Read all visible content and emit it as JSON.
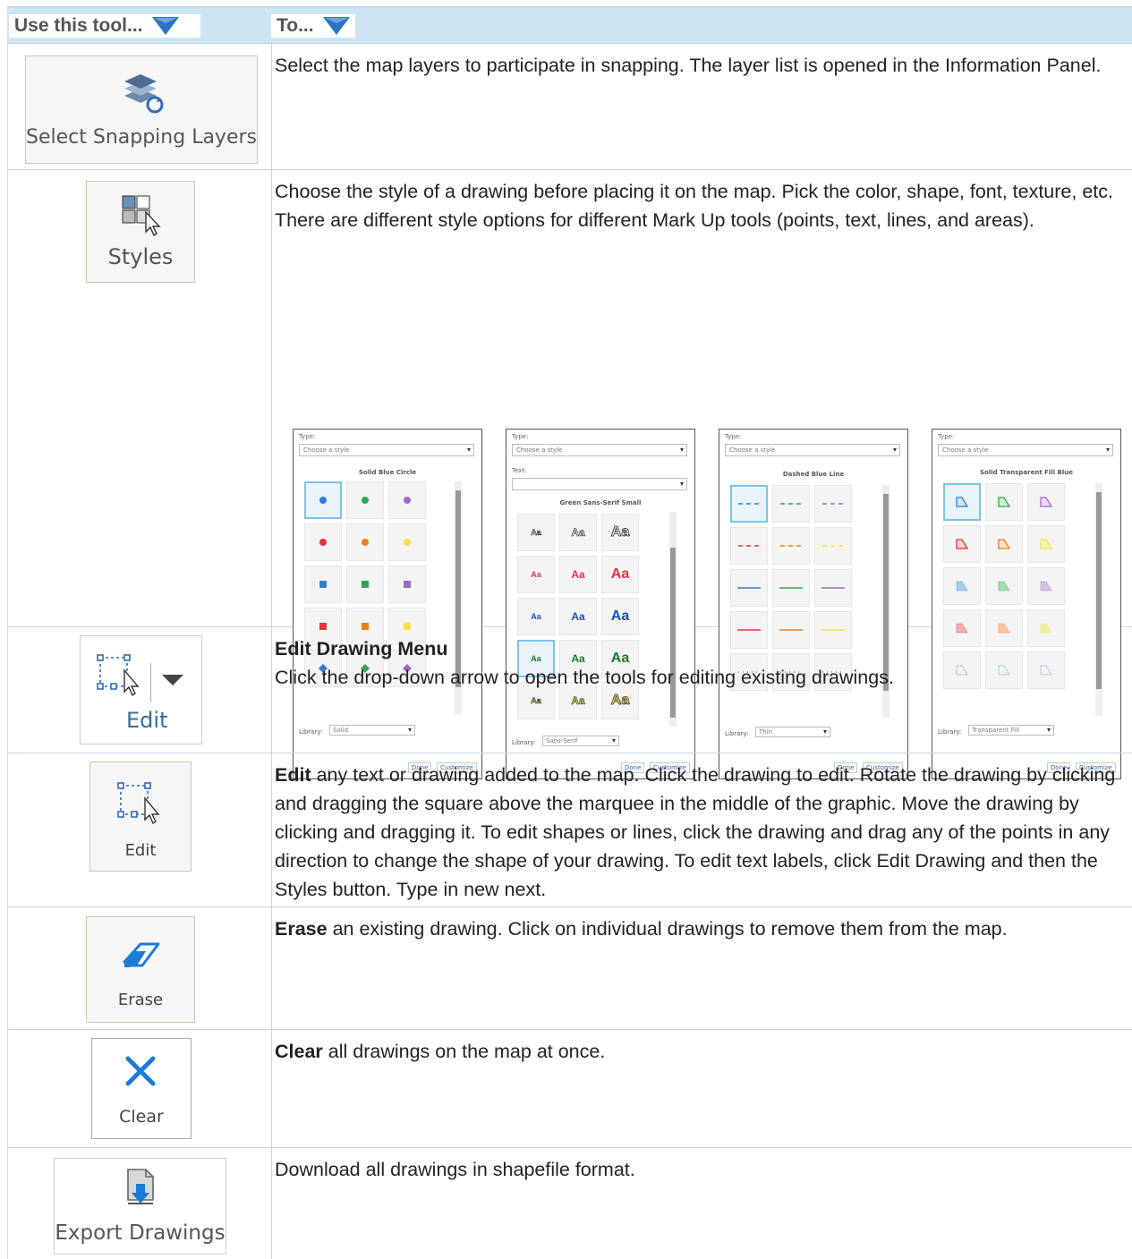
{
  "header": {
    "col1_label": "Use this tool...",
    "col2_label": "To...",
    "funnel_icon": "filter-triangle-icon"
  },
  "rows": [
    {
      "tool_label": "Select Snapping Layers",
      "icon": "layers-snap-icon",
      "desc": "Select the map layers to participate in snapping. The layer list is opened in the Information Panel."
    },
    {
      "tool_label": "Styles",
      "icon": "styles-grid-cursor-icon",
      "desc": "Choose the style of a drawing before placing it on the map. Pick the color, shape, font, texture, etc. There are different style options for different Mark Up tools (points, text, lines, and areas).",
      "panels": [
        {
          "type_label": "Type:",
          "select": "Choose a style",
          "title": "Solid Blue Circle",
          "library_label": "Library:",
          "library": "Solid",
          "done": "Done",
          "customize": "Customize"
        },
        {
          "type_label": "Type:",
          "select": "Choose a style",
          "text_label": "Text:",
          "title": "Green Sans-Serif Small",
          "library_label": "Library:",
          "library": "Sans-Serif",
          "done": "Done",
          "customize": "Customize"
        },
        {
          "type_label": "Type:",
          "select": "Choose a style",
          "title": "Dashed Blue Line",
          "library_label": "Library:",
          "library": "Thin",
          "done": "Done",
          "customize": "Customize"
        },
        {
          "type_label": "Type:",
          "select": "Choose a style",
          "title": "Solid Transparent Fill Blue",
          "library_label": "Library:",
          "library": "Transparent Fill",
          "done": "Done",
          "customize": "Customize"
        }
      ]
    },
    {
      "tool_label": "Edit",
      "icon": "edit-marquee-cursor-icon",
      "desc_title": "Edit Drawing Menu",
      "desc": "Click the drop-down arrow to open the tools for editing existing drawings."
    },
    {
      "tool_label": "Edit",
      "icon": "edit-marquee-cursor-icon",
      "desc_bold": "Edit",
      "desc": " any text or drawing added to the map. Click the drawing to edit. Rotate the drawing by clicking and dragging the square above the marquee in the middle of the graphic. Move the drawing by clicking and dragging it. To edit shapes or lines, click the drawing and drag any of the points in any direction to change the shape of your drawing. To edit text labels, click Edit Drawing and then the Styles button. Type in new next."
    },
    {
      "tool_label": "Erase",
      "icon": "eraser-icon",
      "desc_bold": "Erase",
      "desc": " an existing drawing. Click on individual drawings to remove them from the map."
    },
    {
      "tool_label": "Clear",
      "icon": "close-x-icon",
      "desc_bold": "Clear",
      "desc": " all drawings on the map at once."
    },
    {
      "tool_label": "Export Drawings",
      "icon": "export-download-icon",
      "desc": "Download all drawings in shapefile format."
    }
  ],
  "colors": {
    "header_bg": "#cde4f2",
    "funnel": "#2a74c0",
    "accent_blue": "#1c7bd6"
  }
}
